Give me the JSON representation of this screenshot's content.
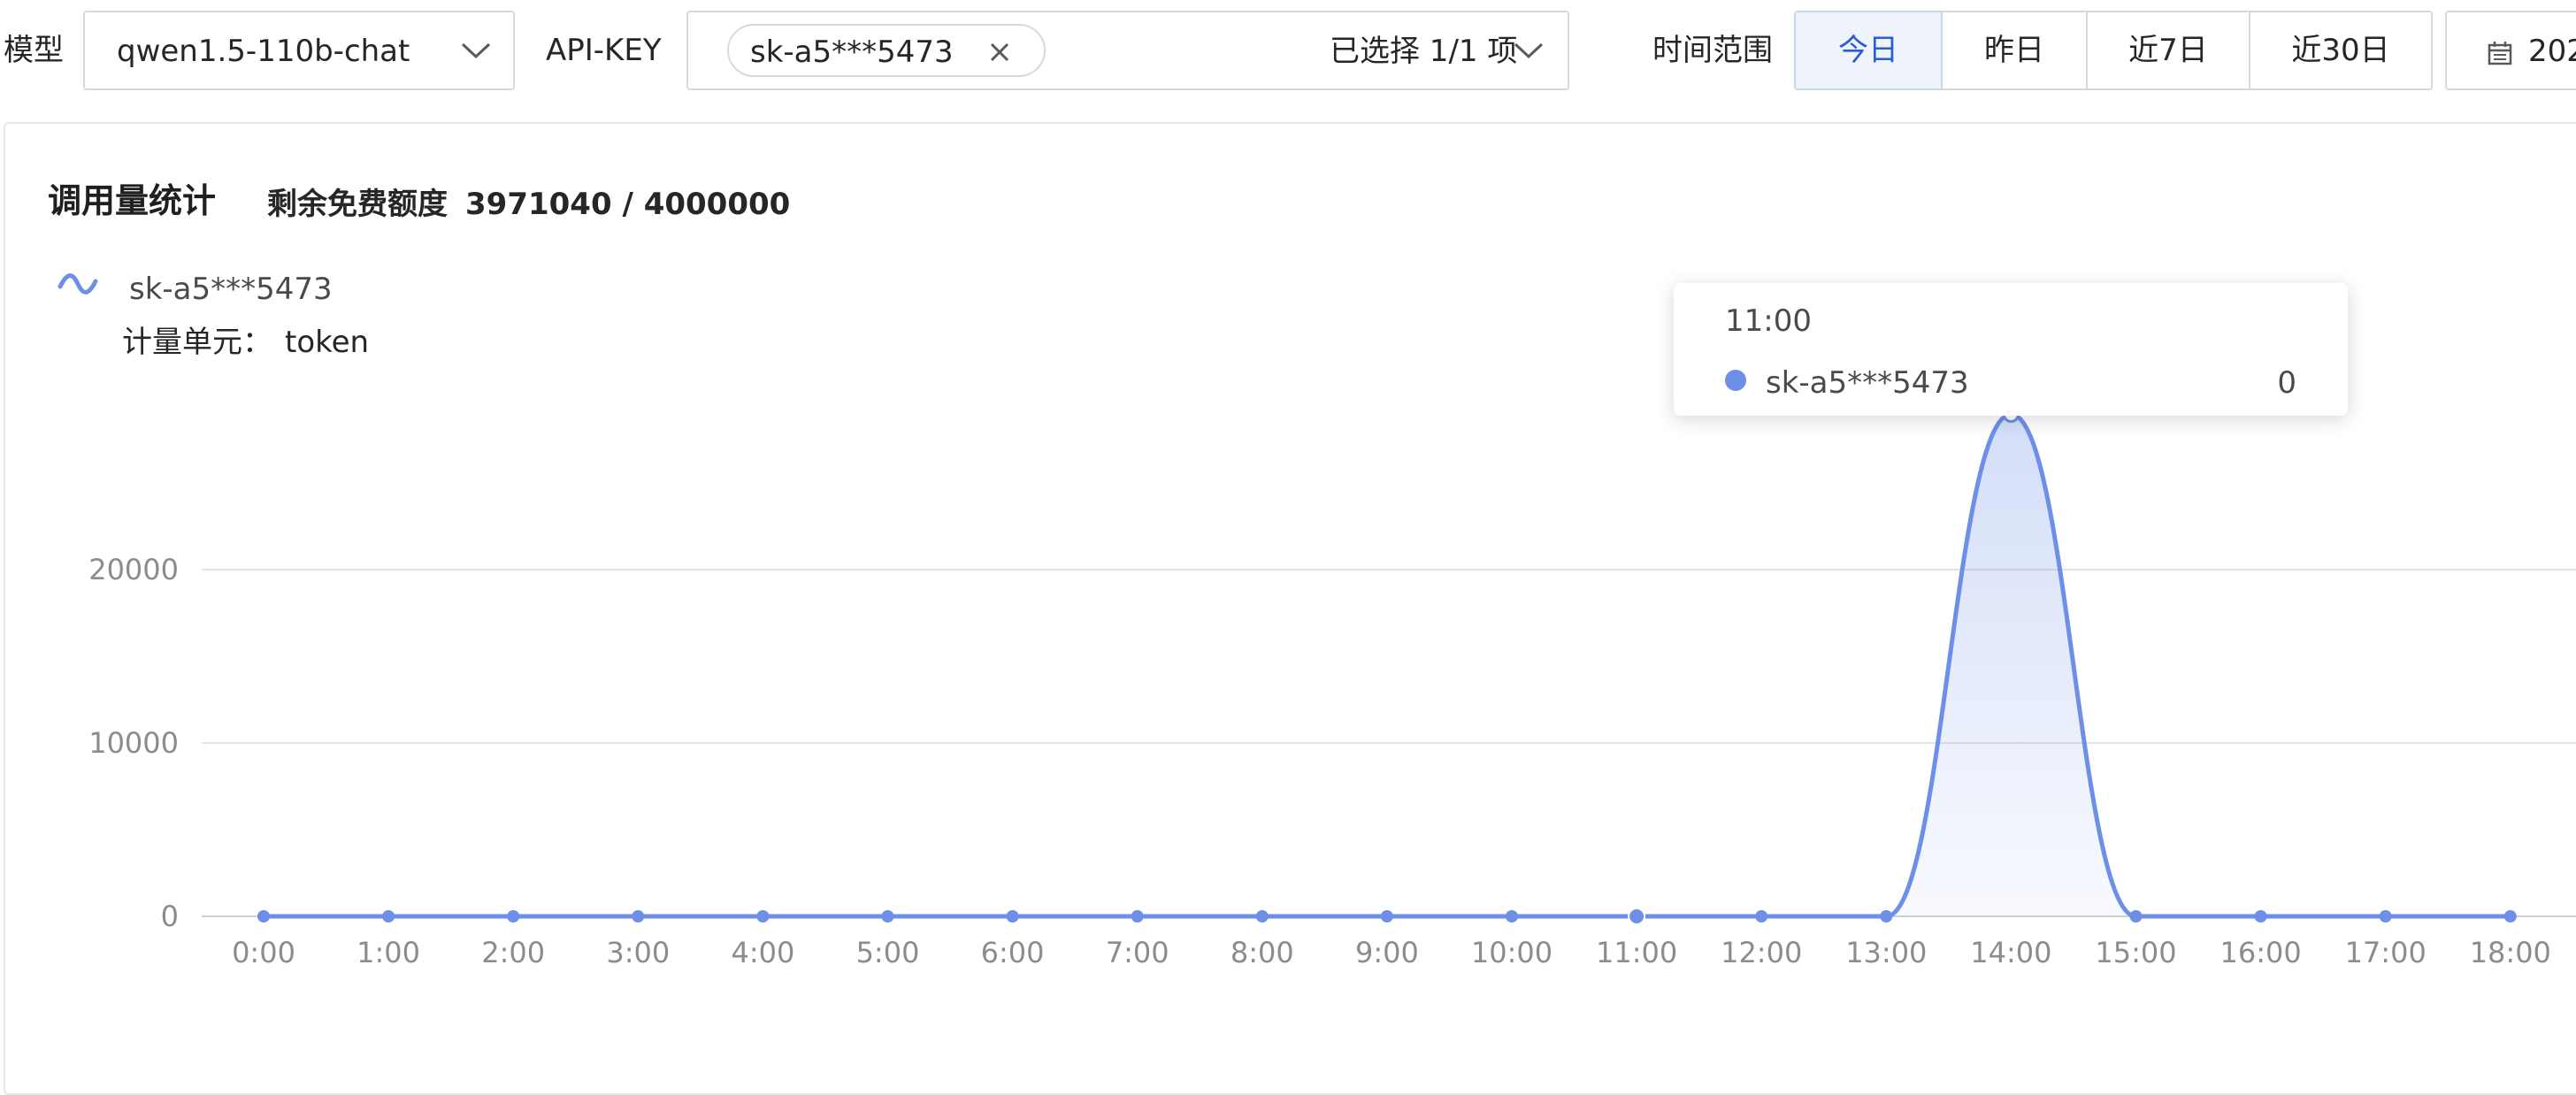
{
  "filters": {
    "model_label": "模型",
    "model_value": "qwen1.5-110b-chat",
    "apikey_label": "API-KEY",
    "apikey_tag": "sk-a5***5473",
    "apikey_summary": "已选择 1/1 项",
    "time_label": "时间范围",
    "time_options": [
      "今日",
      "昨日",
      "近7日",
      "近30日"
    ],
    "time_selected": "今日",
    "date_value": "202"
  },
  "panel": {
    "title": "调用量统计",
    "quota_label": "剩余免费额度",
    "quota_value": "3971040 / 4000000"
  },
  "legend": {
    "series_name": "sk-a5***5473",
    "unit_label": "计量单元：",
    "unit_value": "token"
  },
  "tooltip": {
    "time": "11:00",
    "series_name": "sk-a5***5473",
    "value": "0"
  },
  "colors": {
    "series": "#6e8fe8",
    "active_tab_text": "#2a5cd6",
    "active_tab_bg": "#eef3fc"
  },
  "chart_data": {
    "type": "area",
    "x": [
      "0:00",
      "1:00",
      "2:00",
      "3:00",
      "4:00",
      "5:00",
      "6:00",
      "7:00",
      "8:00",
      "9:00",
      "10:00",
      "11:00",
      "12:00",
      "13:00",
      "14:00",
      "15:00",
      "16:00",
      "17:00",
      "18:00"
    ],
    "series": [
      {
        "name": "sk-a5***5473",
        "values": [
          0,
          0,
          0,
          0,
          0,
          0,
          0,
          0,
          0,
          0,
          0,
          0,
          0,
          0,
          28960,
          0,
          0,
          0,
          0
        ]
      }
    ],
    "y_ticks": [
      "0",
      "10000",
      "20000"
    ],
    "ylim": [
      0,
      30000
    ],
    "grid": true,
    "smooth": true,
    "highlighted_x": "11:00"
  }
}
